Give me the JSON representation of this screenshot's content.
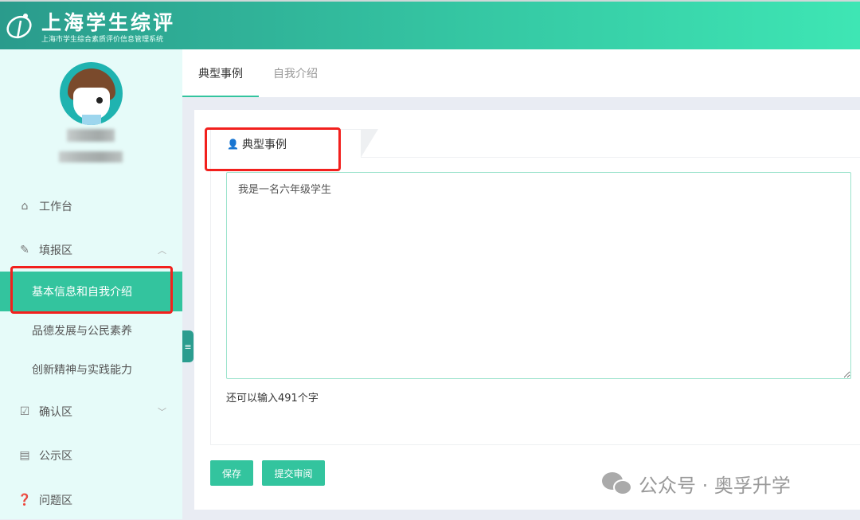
{
  "header": {
    "title": "上海学生综评",
    "subtitle": "上海市学生综合素质评价信息管理系统"
  },
  "sidebar": {
    "items": [
      {
        "label": "工作台",
        "icon": "home-icon"
      },
      {
        "label": "填报区",
        "icon": "edit-icon"
      },
      {
        "label": "确认区",
        "icon": "checkbox-icon"
      },
      {
        "label": "公示区",
        "icon": "newspaper-icon"
      },
      {
        "label": "问题区",
        "icon": "question-icon"
      }
    ],
    "subitems": [
      "基本信息和自我介绍",
      "品德发展与公民素养",
      "创新精神与实践能力"
    ]
  },
  "tabs": [
    "典型事例",
    "自我介绍"
  ],
  "card": {
    "tab_label": "典型事例",
    "text": "我是一名六年级学生",
    "counter": "还可以输入491个字"
  },
  "buttons": {
    "save": "保存",
    "submit": "提交审阅"
  },
  "watermark": "公众号 · 奥孚升学",
  "colors": {
    "accent": "#33c49e",
    "highlight": "#f2201d"
  }
}
